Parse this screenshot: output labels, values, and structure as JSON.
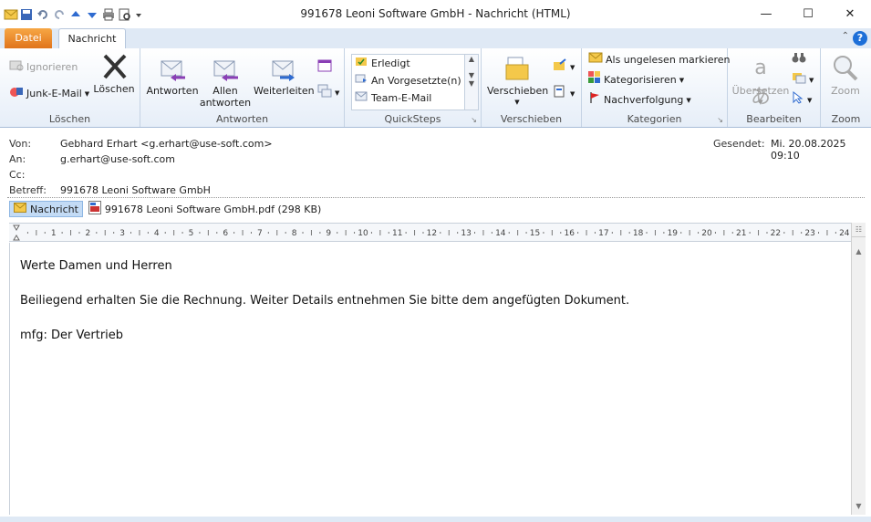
{
  "window": {
    "title": "991678 Leoni Software GmbH  -  Nachricht (HTML)",
    "minimize": "—",
    "maximize": "☐",
    "close": "✕"
  },
  "tabs": {
    "file": "Datei",
    "message": "Nachricht"
  },
  "ribbon": {
    "loeschen": {
      "ignore": "Ignorieren",
      "junk": "Junk-E-Mail",
      "delete": "Löschen",
      "label": "Löschen"
    },
    "antworten": {
      "reply": "Antworten",
      "reply_all_1": "Allen",
      "reply_all_2": "antworten",
      "forward": "Weiterleiten",
      "label": "Antworten"
    },
    "quicksteps": {
      "items": [
        "Erledigt",
        "An Vorgesetzte(n)",
        "Team-E-Mail"
      ],
      "label": "QuickSteps"
    },
    "verschieben": {
      "move": "Verschieben",
      "label": "Verschieben"
    },
    "kategorien": {
      "unread": "Als ungelesen markieren",
      "categorize": "Kategorisieren",
      "followup": "Nachverfolgung",
      "label": "Kategorien"
    },
    "bearbeiten": {
      "translate": "Übersetzen",
      "label": "Bearbeiten"
    },
    "zoom": {
      "zoom": "Zoom",
      "label": "Zoom"
    }
  },
  "header": {
    "from_label": "Von:",
    "from": "Gebhard Erhart <g.erhart@use-soft.com>",
    "to_label": "An:",
    "to": "g.erhart@use-soft.com",
    "cc_label": "Cc:",
    "cc": "",
    "subject_label": "Betreff:",
    "subject": "991678 Leoni Software GmbH",
    "sent_label": "Gesendet:",
    "sent": "Mi. 20.08.2025 09:10"
  },
  "attachments": {
    "message_tab": "Nachricht",
    "file": "991678 Leoni Software GmbH.pdf (298 KB)"
  },
  "ruler": {
    "marks": [
      "1",
      "2",
      "3",
      "4",
      "5",
      "6",
      "7",
      "8",
      "9",
      "10",
      "11",
      "12",
      "13",
      "14",
      "15",
      "16",
      "17",
      "18",
      "19",
      "20",
      "21",
      "22",
      "23",
      "24"
    ]
  },
  "body": {
    "line1": "Werte Damen und Herren",
    "line2": "Beiliegend erhalten Sie die Rechnung. Weiter Details entnehmen Sie bitte dem angefügten Dokument.",
    "line3": "mfg: Der Vertrieb"
  }
}
